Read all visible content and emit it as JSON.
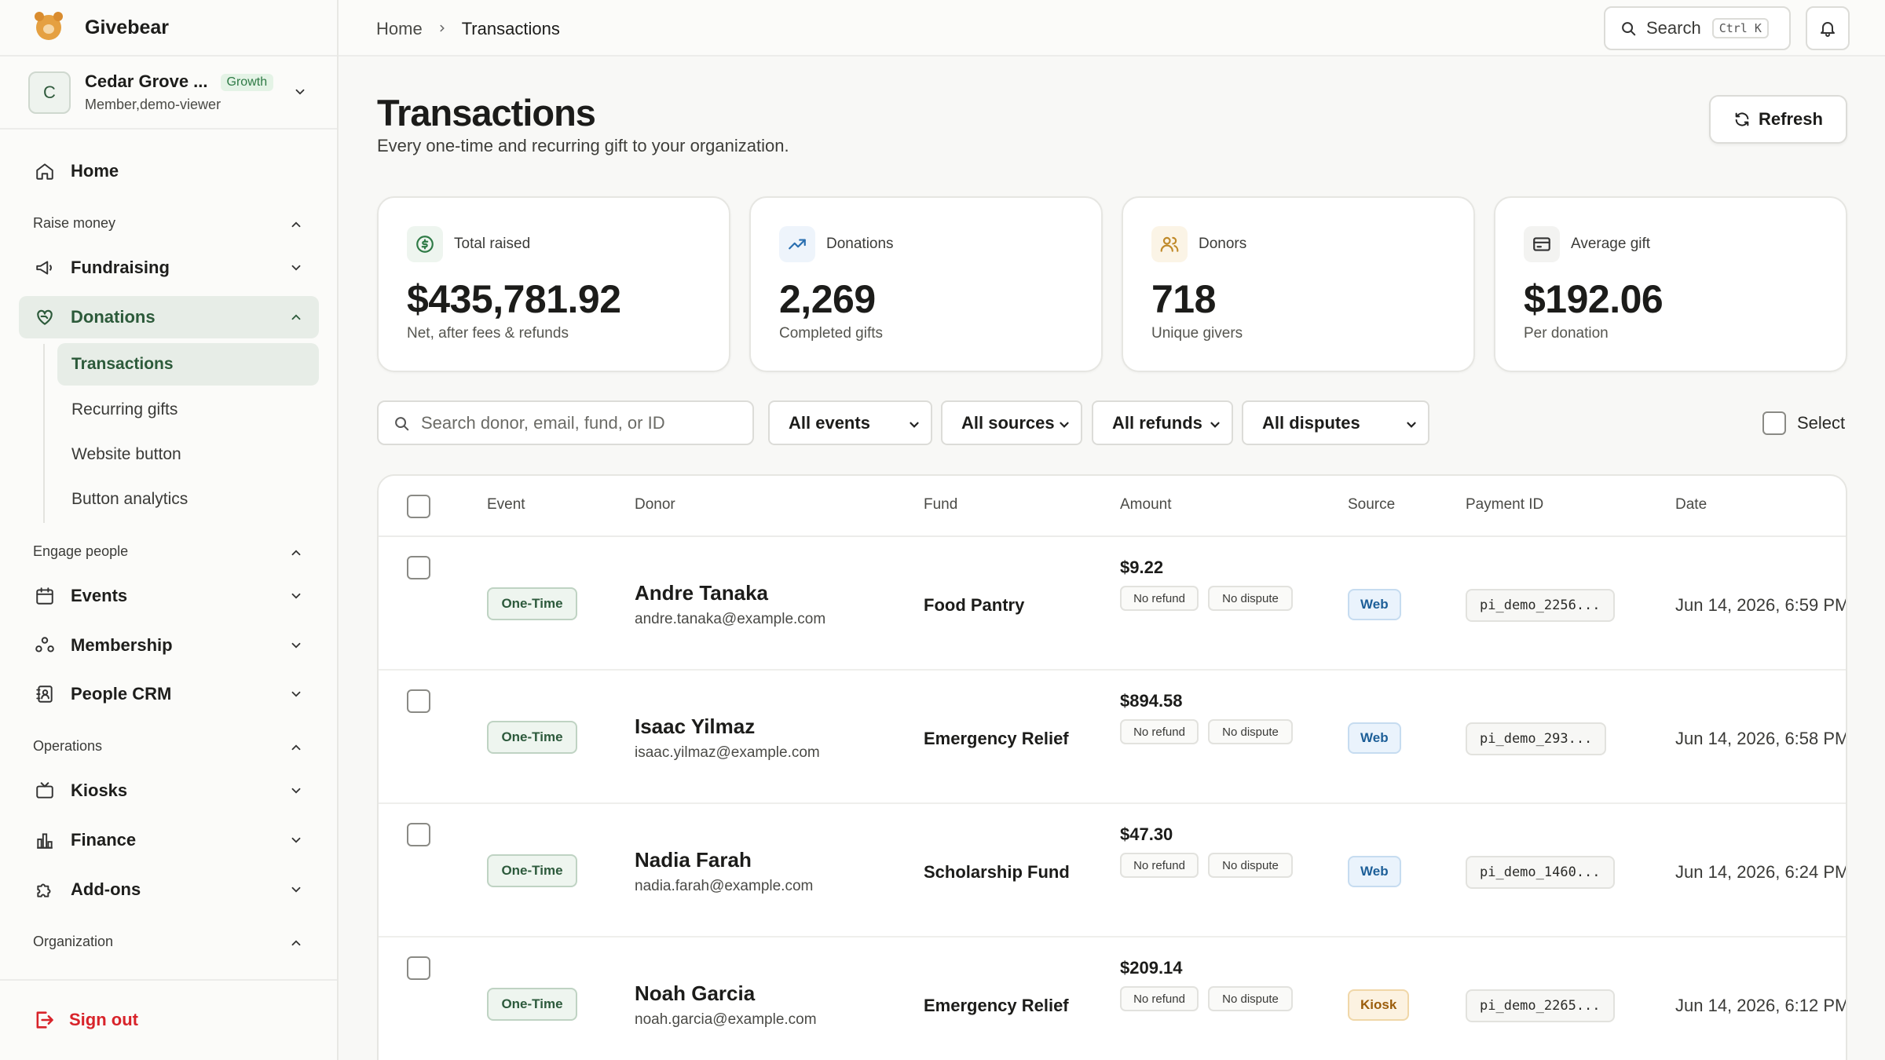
{
  "app": {
    "name": "Givebear"
  },
  "org": {
    "initial": "C",
    "name": "Cedar Grove ...",
    "plan": "Growth",
    "role": "Member,demo-viewer"
  },
  "nav": {
    "home": "Home",
    "sections": {
      "raise": "Raise money",
      "engage": "Engage people",
      "operations": "Operations",
      "organization": "Organization"
    },
    "fundraising": "Fundraising",
    "donations": "Donations",
    "donation_sub": [
      "Transactions",
      "Recurring gifts",
      "Website button",
      "Button analytics"
    ],
    "events": "Events",
    "membership": "Membership",
    "people_crm": "People CRM",
    "kiosks": "Kiosks",
    "finance": "Finance",
    "addons": "Add-ons",
    "signout": "Sign out"
  },
  "topbar": {
    "breadcrumb": [
      "Home",
      "Transactions"
    ],
    "search_label": "Search",
    "search_kbd": "Ctrl K"
  },
  "page": {
    "title": "Transactions",
    "subtitle": "Every one-time and recurring gift to your organization.",
    "refresh": "Refresh"
  },
  "stats": [
    {
      "label": "Total raised",
      "value": "$435,781.92",
      "note": "Net, after fees & refunds",
      "icon": "dollar-circle-icon",
      "color": "#2e7a45"
    },
    {
      "label": "Donations",
      "value": "2,269",
      "note": "Completed gifts",
      "icon": "trending-up-icon",
      "color": "#2a6fb0"
    },
    {
      "label": "Donors",
      "value": "718",
      "note": "Unique givers",
      "icon": "users-icon",
      "color": "#c08a2a"
    },
    {
      "label": "Average gift",
      "value": "$192.06",
      "note": "Per donation",
      "icon": "credit-card-icon",
      "color": "#3a3a37"
    }
  ],
  "filters": {
    "search_placeholder": "Search donor, email, fund, or ID",
    "events": "All events",
    "sources": "All sources",
    "refunds": "All refunds",
    "disputes": "All disputes",
    "select_label": "Select"
  },
  "table": {
    "columns": [
      "Event",
      "Donor",
      "Fund",
      "Amount",
      "Source",
      "Payment ID",
      "Date"
    ],
    "rows": [
      {
        "event": "One-Time",
        "name": "Andre Tanaka",
        "email": "andre.tanaka@example.com",
        "fund": "Food Pantry",
        "amount": "$9.22",
        "refund": "No refund",
        "dispute": "No dispute",
        "source": "Web",
        "payment_id": "pi_demo_2256...",
        "date": "Jun 14, 2026, 6:59 PM"
      },
      {
        "event": "One-Time",
        "name": "Isaac Yilmaz",
        "email": "isaac.yilmaz@example.com",
        "fund": "Emergency Relief",
        "amount": "$894.58",
        "refund": "No refund",
        "dispute": "No dispute",
        "source": "Web",
        "payment_id": "pi_demo_293...",
        "date": "Jun 14, 2026, 6:58 PM"
      },
      {
        "event": "One-Time",
        "name": "Nadia Farah",
        "email": "nadia.farah@example.com",
        "fund": "Scholarship Fund",
        "amount": "$47.30",
        "refund": "No refund",
        "dispute": "No dispute",
        "source": "Web",
        "payment_id": "pi_demo_1460...",
        "date": "Jun 14, 2026, 6:24 PM"
      },
      {
        "event": "One-Time",
        "name": "Noah Garcia",
        "email": "noah.garcia@example.com",
        "fund": "Emergency Relief",
        "amount": "$209.14",
        "refund": "No refund",
        "dispute": "No dispute",
        "source": "Kiosk",
        "payment_id": "pi_demo_2265...",
        "date": "Jun 14, 2026, 6:12 PM"
      }
    ]
  },
  "colors": {
    "accent": "#2c5a3a",
    "danger": "#d8232a"
  }
}
